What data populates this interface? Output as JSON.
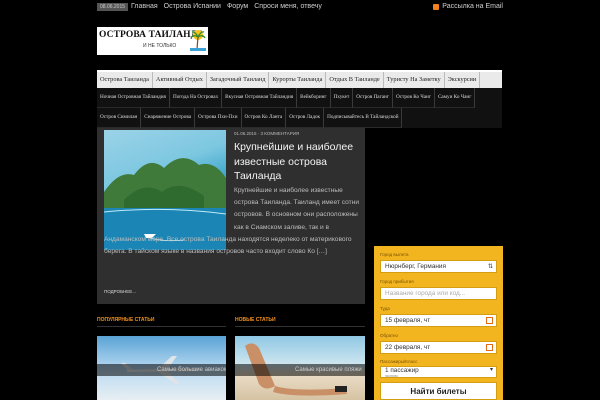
{
  "topbar": {
    "date": "08.06.2015",
    "nav": [
      "Главная",
      "Острова Испании",
      "Форум",
      "Спроси меня, отвечу"
    ],
    "subscribe": "Рассылка на Email"
  },
  "logo": {
    "title": "ОСТРОВА ТАИЛАНДА",
    "subtitle": "И НЕ ТОЛЬКО"
  },
  "main_nav": [
    "Острова Таиланда",
    "Активный Отдых",
    "Загадочный Таиланд",
    "Курорты Таиланда",
    "Отдых В Таиланде",
    "Туристу На Заметку",
    "Экскурсии"
  ],
  "sub_nav": [
    "Ночная Островная Тайландия",
    "Погода На Островах",
    "Вкусная Островная Тайландия",
    "Вейкборинг",
    "Пхукет",
    "Остров Паганг",
    "Остров Ко Чанг",
    "Самуи Ко Чанг",
    "Остров Симилан",
    "Снаряжение Острова",
    "Острова Пхи-Пхи",
    "Остров Ко Ланта",
    "Остров Ладок",
    "Подписывайтесь В Тайландской"
  ],
  "post": {
    "meta": "01.06.2015 · 3 КОММЕНТАРИЯ",
    "title": "Крупнейшие и наиболее известные острова Таиланда",
    "excerpt": "Крупнейшие и наиболее известные острова Таиланда. Таиланд имеет сотни островов. В основном они расположены как в Сиамском заливе, так и в Андаманском море. Все острова Таиланда находятся неделеко от материкового берега. В тайском языке в названия островов часто входит слово Ко […]",
    "more": "ПОДРОБНЕЕ..."
  },
  "sections": {
    "popular": "ПОПУЛЯРНЫЕ СТАТЬИ",
    "new": "НОВЫЕ СТАТЬИ",
    "popular_caption": "Самые большие авиакомпании мира",
    "new_caption": "Самые красивые пляжи"
  },
  "widget": {
    "from_label": "Город вылета",
    "from_value": "Нюрнберг, Германия",
    "to_label": "Город прибытия",
    "to_placeholder": "Название города или код...",
    "depart_label": "Туда",
    "depart_value": "15 февраля, чт",
    "return_label": "Обратно",
    "return_value": "22 февраля, чт",
    "pax_label": "Пассажиры/Класс",
    "pax_value": "1 пассажир",
    "pax_sub": "эконом",
    "button": "Найти билеты"
  }
}
